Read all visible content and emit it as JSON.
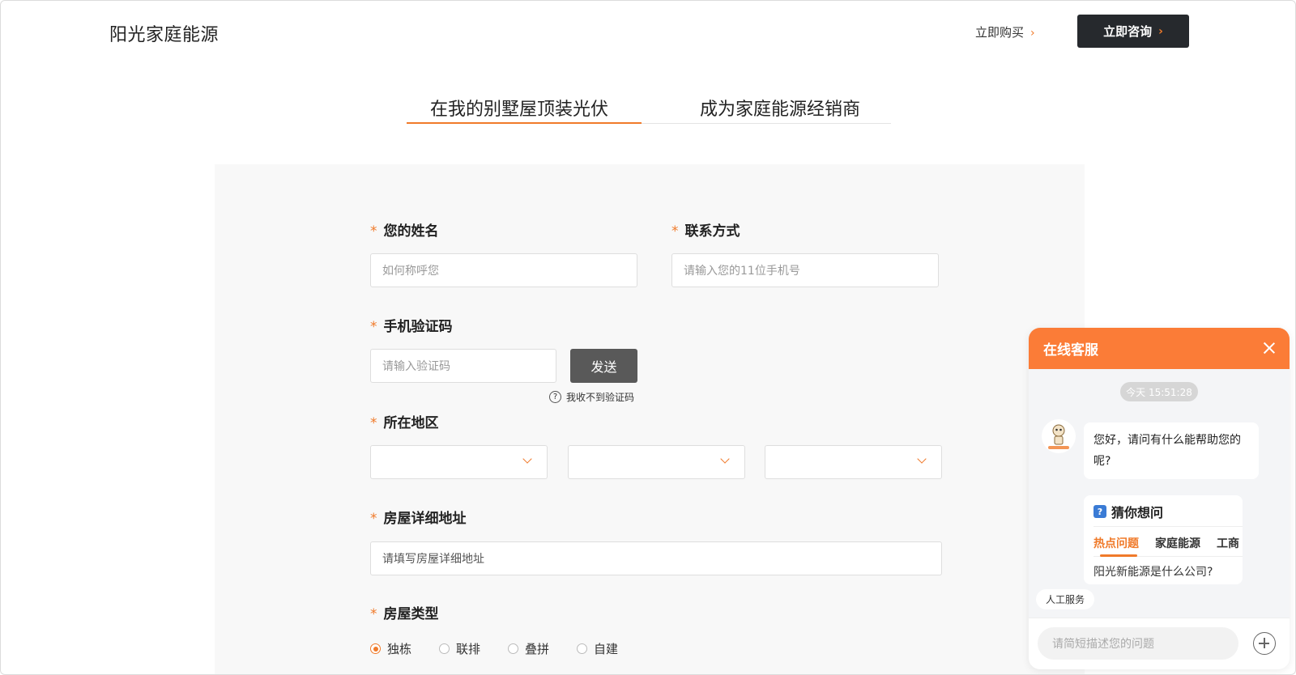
{
  "header": {
    "brand": "阳光家庭能源",
    "buy_label": "立即购买",
    "consult_label": "立即咨询",
    "chevron": "›"
  },
  "tabs": [
    {
      "label": "在我的别墅屋顶装光伏",
      "active": true
    },
    {
      "label": "成为家庭能源经销商",
      "active": false
    }
  ],
  "form": {
    "required_mark": "*",
    "name": {
      "label": "您的姓名",
      "placeholder": "如何称呼您"
    },
    "contact": {
      "label": "联系方式",
      "placeholder": "请输入您的11位手机号"
    },
    "code": {
      "label": "手机验证码",
      "placeholder": "请输入验证码",
      "send_label": "发送",
      "help_label": "我收不到验证码",
      "help_icon": "?"
    },
    "region": {
      "label": "所在地区",
      "selects": [
        "",
        "",
        ""
      ]
    },
    "address": {
      "label": "房屋详细地址",
      "placeholder": "请填写房屋详细地址"
    },
    "house_type": {
      "label": "房屋类型",
      "options": [
        "独栋",
        "联排",
        "叠拼",
        "自建"
      ],
      "selected": "独栋"
    }
  },
  "chat": {
    "title": "在线客服",
    "time": "今天 15:51:28",
    "greeting": "您好，请问有什么能帮助您的呢?",
    "guess": {
      "title": "猜你想问",
      "icon_glyph": "?",
      "tabs": [
        "热点问题",
        "家庭能源",
        "工商"
      ],
      "question": "阳光新能源是什么公司?"
    },
    "human_service": "人工服务",
    "input_placeholder": "请简短描述您的问题"
  },
  "colors": {
    "accent": "#f07a2a",
    "chat_header": "#fb7c37",
    "dark_button": "#26292d",
    "send_button": "#595959"
  }
}
